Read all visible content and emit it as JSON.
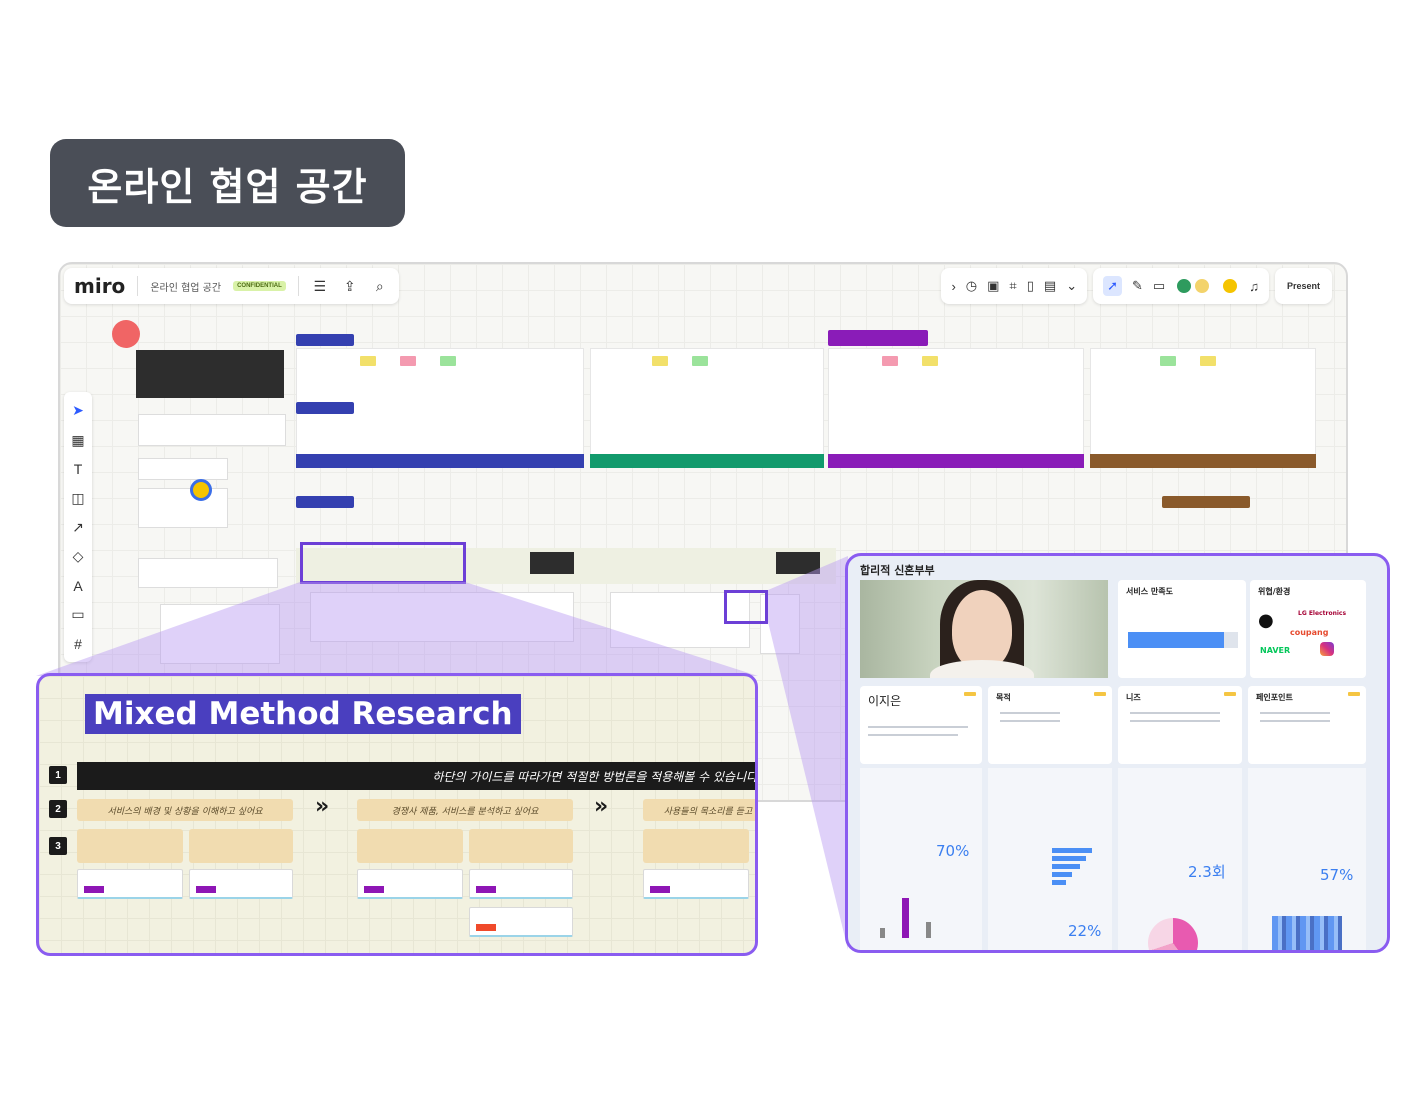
{
  "badge": {
    "title": "온라인 협업 공간"
  },
  "miro": {
    "logo": "miro",
    "board_name": "온라인 협업 공간",
    "confidential": "CONFIDENTIAL",
    "present_label": "Present",
    "icons": {
      "menu": "menu-icon",
      "upload": "upload-icon",
      "search": "search-icon",
      "timer": "timer-icon",
      "select": "select-icon"
    }
  },
  "mmr": {
    "title": "Mixed Method Research",
    "steps": [
      "1",
      "2",
      "3"
    ],
    "guide": "하단의 가이드를 따라가면 적절한 방법론을 적용해볼 수 있습니다.",
    "questions": [
      "서비스의 배경 및 상황을 이해하고 싶어요",
      "경쟁사 제품, 서비스를 분석하고 싶어요",
      "사용들의 목소리를 듣고"
    ],
    "arrow": "»"
  },
  "persona": {
    "title": "합리적 신혼부부",
    "name": "이지은",
    "card_titles": [
      "서비스 만족도",
      "위협/환경"
    ],
    "section_titles": [
      "목적",
      "니즈",
      "페인포인트"
    ],
    "stats": [
      "70%",
      "22%",
      "2.3회",
      "57%"
    ],
    "brands": [
      "LG Electronics",
      "coupang",
      "NAVER"
    ]
  },
  "colors": {
    "accent_purple": "#8a5cf0",
    "badge_bg": "#4a4e57",
    "title_bg": "#4a3fbf",
    "stage_blue": "#3440b0",
    "stage_green": "#129a6c",
    "stage_purple": "#8a1cb8",
    "stage_brown": "#8a5a2b"
  }
}
